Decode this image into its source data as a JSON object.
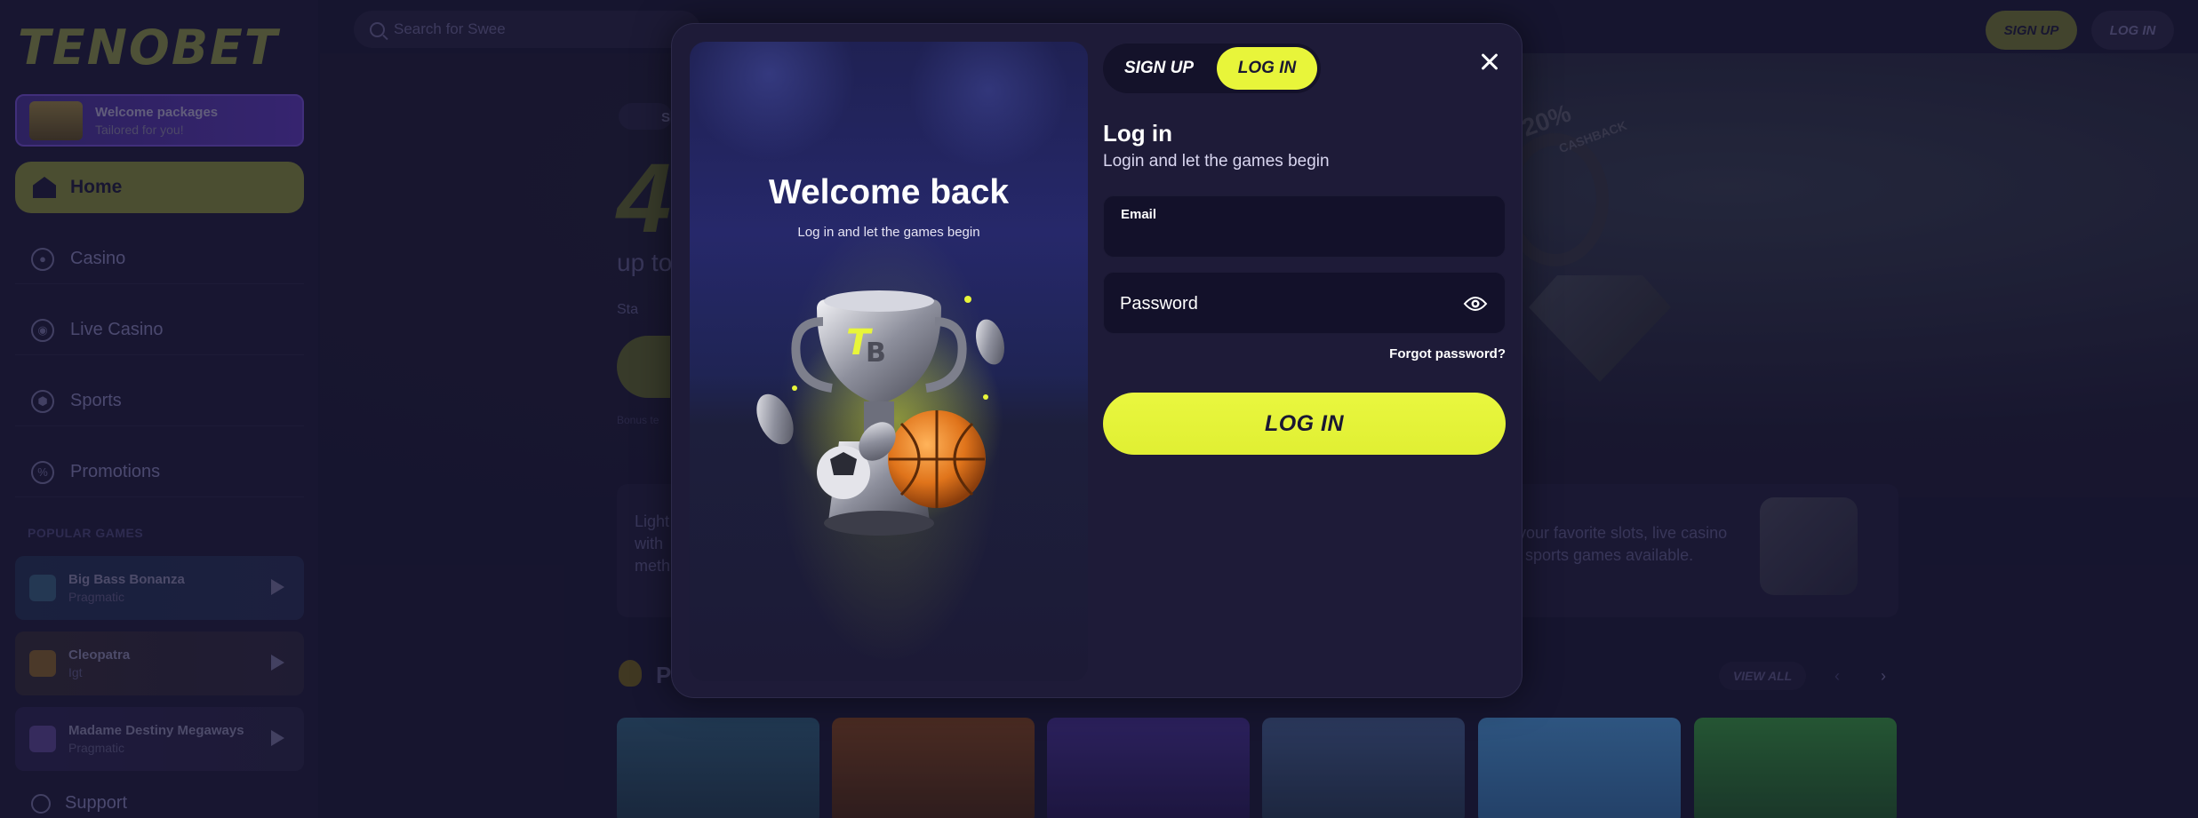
{
  "brand": {
    "logo_text": "TENOBET",
    "accent": "#e8f53a",
    "background": "#1a1733"
  },
  "header": {
    "search_placeholder": "Search for Swee",
    "signup_label": "SIGN UP",
    "login_label": "LOG IN"
  },
  "sidebar": {
    "promo": {
      "title": "Welcome packages",
      "subtitle": "Tailored for you!"
    },
    "items": [
      {
        "label": "Home",
        "icon": "home-icon",
        "active": true
      },
      {
        "label": "Casino",
        "icon": "casino-chip-icon"
      },
      {
        "label": "Live Casino",
        "icon": "broadcast-icon"
      },
      {
        "label": "Sports",
        "icon": "soccer-ball-icon"
      },
      {
        "label": "Promotions",
        "icon": "percent-icon"
      }
    ],
    "popular_label": "POPULAR GAMES",
    "games": [
      {
        "name": "Big Bass Bonanza",
        "provider": "Pragmatic"
      },
      {
        "name": "Cleopatra",
        "provider": "Igt"
      },
      {
        "name": "Madame Destiny Megaways",
        "provider": "Pragmatic"
      }
    ],
    "support_label": "Support"
  },
  "background": {
    "hero_chip": "S",
    "hero_big": "4",
    "hero_upto": "up to",
    "hero_start": "Sta",
    "hero_bonus": "Bonus te",
    "cashback_pct": "20%",
    "cashback_label": "CASHBACK",
    "info_left": "Light with meth",
    "info_right_line1": "your favorite slots, live casino",
    "info_right_line2": "sports games available.",
    "popular_title": "P",
    "view_all": "VIEW ALL"
  },
  "modal": {
    "welcome_title": "Welcome back",
    "welcome_sub": "Log in and let the games begin",
    "tabs": {
      "signup": "SIGN UP",
      "login": "LOG IN"
    },
    "form_title": "Log in",
    "form_sub": "Login and let the games begin",
    "email_label": "Email",
    "email_value": "",
    "password_placeholder": "Password",
    "forgot_password": "Forgot password?",
    "submit_label": "LOG IN"
  }
}
